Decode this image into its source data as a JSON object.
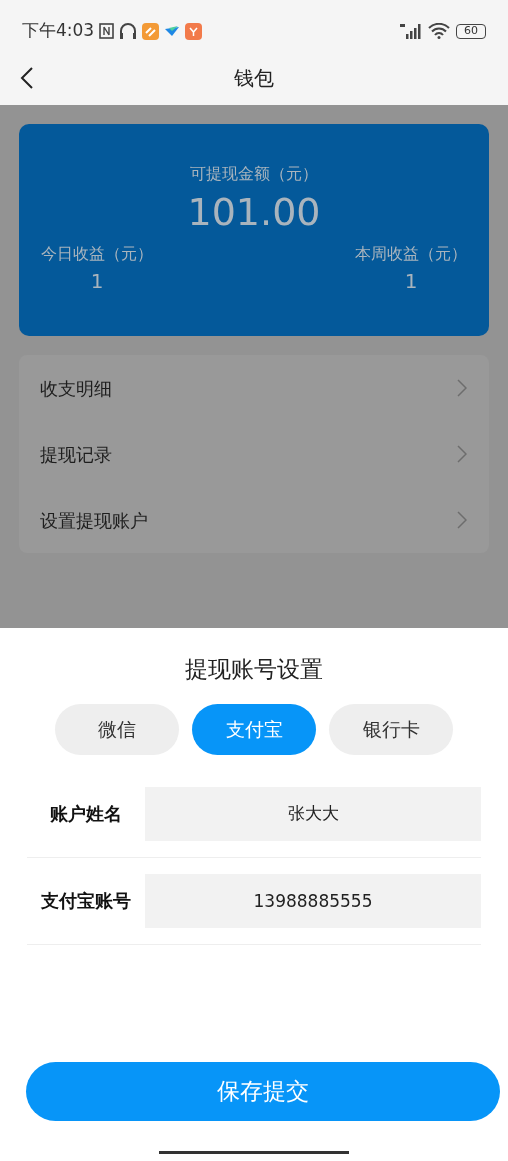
{
  "status_bar": {
    "time": "下午4:03",
    "battery": "60"
  },
  "nav": {
    "title": "钱包"
  },
  "balance_card": {
    "label": "可提现金额（元）",
    "amount": "101.00",
    "today_label": "今日收益（元）",
    "today_value": "1",
    "week_label": "本周收益（元）",
    "week_value": "1"
  },
  "menu": [
    {
      "label": "收支明细"
    },
    {
      "label": "提现记录"
    },
    {
      "label": "设置提现账户"
    }
  ],
  "sheet": {
    "title": "提现账号设置",
    "tabs": [
      {
        "label": "微信",
        "selected": false
      },
      {
        "label": "支付宝",
        "selected": true
      },
      {
        "label": "银行卡",
        "selected": false
      }
    ],
    "fields": [
      {
        "label": "账户姓名",
        "value": "张大大"
      },
      {
        "label": "支付宝账号",
        "value": "13988885555"
      }
    ],
    "submit": "保存提交"
  }
}
